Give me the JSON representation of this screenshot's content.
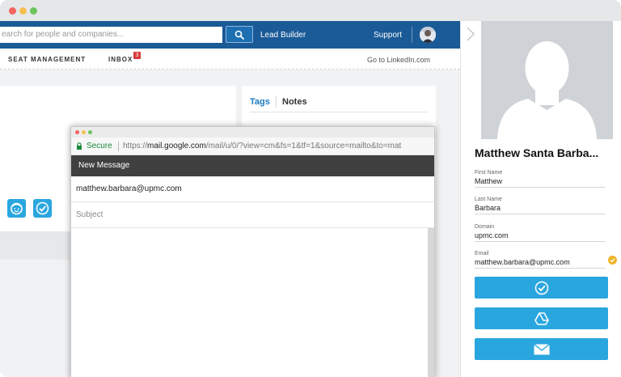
{
  "topnav": {
    "search_placeholder": "earch for people and companies...",
    "lead_builder": "Lead Builder",
    "support": "Support"
  },
  "subnav": {
    "seat_management": "SEAT MANAGEMENT",
    "inbox": "INBOX",
    "inbox_count": "3",
    "goto_linkedin": "Go to LinkedIn.com"
  },
  "tabs": {
    "tags": "Tags",
    "notes": "Notes"
  },
  "compose": {
    "secure": "Secure",
    "url_prefix": "https://",
    "url_host": "mail.google.com",
    "url_path": "/mail/u/0/?view=cm&fs=1&tf=1&source=mailto&to=mat",
    "header": "New Message",
    "to": "matthew.barbara@upmc.com",
    "subject_placeholder": "Subject"
  },
  "profile": {
    "name": "Matthew Santa Barba...",
    "fields": [
      {
        "label": "First Name",
        "value": "Matthew"
      },
      {
        "label": "Last Name",
        "value": "Barbara"
      },
      {
        "label": "Domain",
        "value": "upmc.com"
      },
      {
        "label": "Email",
        "value": "matthew.barbara@upmc.com"
      }
    ],
    "actions": [
      "check-icon",
      "drive-icon",
      "envelope-icon"
    ]
  },
  "colors": {
    "nav_blue": "#1a5a96",
    "accent_blue": "#2aa6df",
    "link_blue": "#1b7ac0",
    "badge_red": "#d63a3a",
    "verified_gold": "#f0b429",
    "compose_header": "#404040"
  }
}
